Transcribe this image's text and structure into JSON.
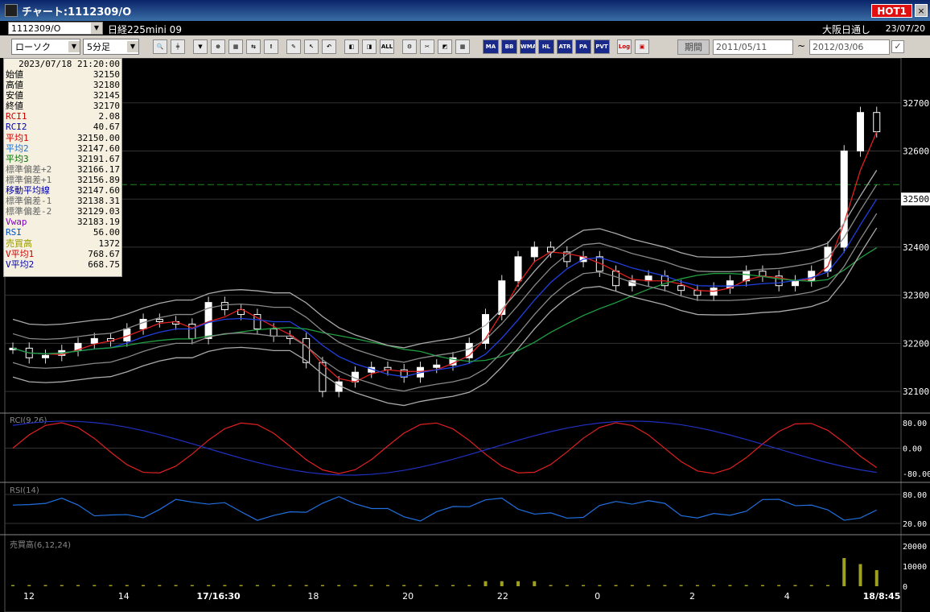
{
  "window": {
    "title": "チャート:1112309/O",
    "hot_badge": "HOT1",
    "close": "×"
  },
  "infobar": {
    "symbol_code": "1112309/O",
    "symbol_name": "日経225mini 09",
    "market": "大阪日通し",
    "date": "23/07/20"
  },
  "toolbar": {
    "chart_type": "ローソク",
    "interval": "5分足",
    "buttons": [
      {
        "name": "zoom-icon",
        "label": "🔍"
      },
      {
        "name": "cursor-lines-icon",
        "label": "╪"
      },
      {
        "name": "indicator-icon-1",
        "label": "▼"
      },
      {
        "name": "zoom-in-icon",
        "label": "⊕"
      },
      {
        "name": "chart-icon-1",
        "label": "▦"
      },
      {
        "name": "chart-icon-2",
        "label": "⇆"
      },
      {
        "name": "warning-icon",
        "label": "!"
      },
      {
        "name": "pen-icon",
        "label": "✎"
      },
      {
        "name": "pointer-icon",
        "label": "↖"
      },
      {
        "name": "undo-icon",
        "label": "↶"
      },
      {
        "name": "remove-icon-1",
        "label": "◧"
      },
      {
        "name": "remove-icon-2",
        "label": "◨"
      },
      {
        "name": "remove-all-icon",
        "label": "ALL"
      },
      {
        "name": "settings-icon",
        "label": "⚙"
      },
      {
        "name": "tool-icon",
        "label": "✂"
      },
      {
        "name": "color-icon",
        "label": "◩"
      },
      {
        "name": "grid-icon",
        "label": "▦"
      }
    ],
    "indicator_buttons": [
      "MA",
      "BB",
      "WMA",
      "HL",
      "ATR",
      "PA",
      "PVT"
    ],
    "extra_buttons": [
      "Log",
      "▣"
    ],
    "period_label": "期間",
    "date_from": "2011/05/11",
    "date_to": "2012/03/06",
    "tilde": "~",
    "check": "✓"
  },
  "info_panel": {
    "timestamp": "2023/07/18 21:20:00",
    "rows": [
      {
        "label": "始値",
        "value": "32150",
        "color": "#000000"
      },
      {
        "label": "高値",
        "value": "32180",
        "color": "#000000"
      },
      {
        "label": "安値",
        "value": "32145",
        "color": "#000000"
      },
      {
        "label": "終値",
        "value": "32170",
        "color": "#000000"
      },
      {
        "label": "RCI1",
        "value": "2.08",
        "color": "#cc0000"
      },
      {
        "label": "RCI2",
        "value": "40.67",
        "color": "#0000aa"
      },
      {
        "label": "平均1",
        "value": "32150.00",
        "color": "#cc0000"
      },
      {
        "label": "平均2",
        "value": "32147.60",
        "color": "#2070d0"
      },
      {
        "label": "平均3",
        "value": "32191.67",
        "color": "#007000"
      },
      {
        "label": "標準偏差+2",
        "value": "32166.17",
        "color": "#666666"
      },
      {
        "label": "標準偏差+1",
        "value": "32156.89",
        "color": "#666666"
      },
      {
        "label": "移動平均線",
        "value": "32147.60",
        "color": "#0000aa"
      },
      {
        "label": "標準偏差-1",
        "value": "32138.31",
        "color": "#666666"
      },
      {
        "label": "標準偏差-2",
        "value": "32129.03",
        "color": "#666666"
      },
      {
        "label": "Vwap",
        "value": "32183.19",
        "color": "#8000c0"
      },
      {
        "label": "RSI",
        "value": "56.00",
        "color": "#0050cc"
      },
      {
        "label": "売買高",
        "value": "1372",
        "color": "#999900"
      },
      {
        "label": "V平均1",
        "value": "768.67",
        "color": "#cc0000"
      },
      {
        "label": "V平均2",
        "value": "668.75",
        "color": "#0000aa"
      }
    ]
  },
  "chart_data": {
    "type": "candlestick",
    "price_axis": {
      "ticks": [
        "32700",
        "32600",
        "32500",
        "32400",
        "32300",
        "32200",
        "32100"
      ],
      "current": "32500",
      "ylim": [
        32060,
        32790
      ]
    },
    "dashed_level": 32530,
    "candles_close": [
      32190,
      32170,
      32175,
      32185,
      32200,
      32210,
      32205,
      32230,
      32250,
      32245,
      32240,
      32210,
      32285,
      32270,
      32260,
      32230,
      32215,
      32210,
      32160,
      32100,
      32120,
      32140,
      32150,
      32145,
      32130,
      32150,
      32155,
      32170,
      32200,
      32260,
      32330,
      32380,
      32400,
      32390,
      32370,
      32380,
      32350,
      32320,
      32330,
      32340,
      32320,
      32310,
      32300,
      32315,
      32330,
      32350,
      32340,
      32320,
      32330,
      32350,
      32400,
      32600,
      32680,
      32640
    ],
    "rci_label": "RCI(9,26)",
    "rci_ticks": [
      "80.00",
      "0.00",
      "-80.00"
    ],
    "rsi_label": "RSI(14)",
    "rsi_ticks": [
      "80.00",
      "20.00"
    ],
    "volume_label": "売買高(6,12,24)",
    "volume_ticks": [
      "20000",
      "10000",
      "0"
    ],
    "x_ticks": [
      "12",
      "14",
      "17/16:30",
      "18",
      "20",
      "22",
      "0",
      "2",
      "4",
      "18/8:45"
    ]
  }
}
